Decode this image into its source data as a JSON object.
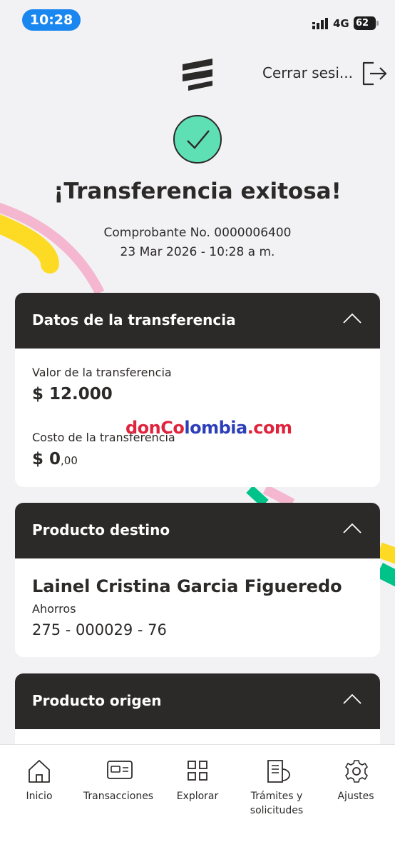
{
  "status_bar": {
    "time": "10:28",
    "network": "4G",
    "battery": "62"
  },
  "header": {
    "logo_icon": "bancolombia-logo-icon",
    "logout_label": "Cerrar sesi...",
    "logout_icon": "logout-icon"
  },
  "success": {
    "icon": "check-icon",
    "title": "¡Transferencia exitosa!",
    "receipt": "Comprobante No. 0000006400",
    "datetime": "23 Mar 2026 - 10:28 a m."
  },
  "transfer_card": {
    "title": "Datos de la transferencia",
    "amount_label": "Valor de la transferencia",
    "amount_value": "$ 12.000",
    "cost_label": "Costo de la transferencia",
    "cost_value": "$ 0",
    "cost_cents": ",00"
  },
  "watermark": {
    "part1": "donCo",
    "part2": "lombia",
    "part3": ".com"
  },
  "destination_card": {
    "title": "Producto destino",
    "holder_name": "Lainel Cristina Garcia Figueredo",
    "account_type": "Ahorros",
    "account_number": "275 - 000029 - 76"
  },
  "origin_card": {
    "title": "Producto origen"
  },
  "bottom_nav": {
    "items": [
      {
        "label": "Inicio",
        "icon": "home-icon"
      },
      {
        "label": "Transacciones",
        "icon": "card-icon"
      },
      {
        "label": "Explorar",
        "icon": "grid-icon"
      },
      {
        "label": "Trámites y solicitudes",
        "icon": "document-icon"
      },
      {
        "label": "Ajustes",
        "icon": "gear-icon"
      }
    ]
  },
  "colors": {
    "dark": "#2c2a29",
    "success_green": "#5fe0b4",
    "accent_yellow": "#fdda24",
    "accent_pink": "#f5b6d0",
    "accent_green": "#00c389"
  }
}
